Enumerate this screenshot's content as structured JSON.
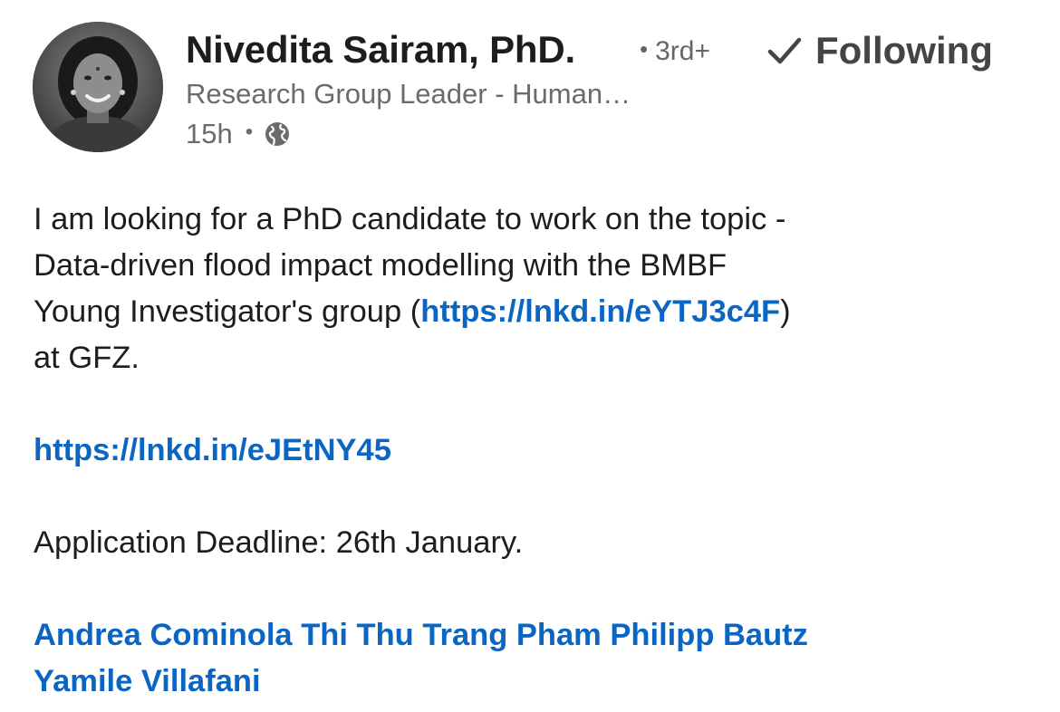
{
  "author": {
    "name": "Nivedita Sairam, PhD.",
    "degree": "3rd+",
    "headline": "Research Group Leader - Human…",
    "time": "15h",
    "visibility_icon": "globe-icon",
    "avatar_icon": "profile-photo"
  },
  "follow": {
    "label": "Following",
    "icon": "checkmark-icon"
  },
  "post": {
    "line1": "I am looking for a PhD candidate to work on the topic -",
    "line2": "Data-driven flood impact modelling with the BMBF",
    "line3_prefix": "Young Investigator's group (",
    "link1": "https://lnkd.in/eYTJ3c4F",
    "line3_suffix": ")",
    "line4": "at GFZ.",
    "link2": "https://lnkd.in/eJEtNY45",
    "deadline": "Application Deadline: 26th January.",
    "mentions": [
      "Andrea Cominola",
      "Thi Thu Trang Pham",
      "Philipp Bautz",
      "Yamile Villafani"
    ]
  },
  "colors": {
    "link": "#0a66c2",
    "text": "#1d1d1d",
    "muted": "#6b6b6b"
  }
}
